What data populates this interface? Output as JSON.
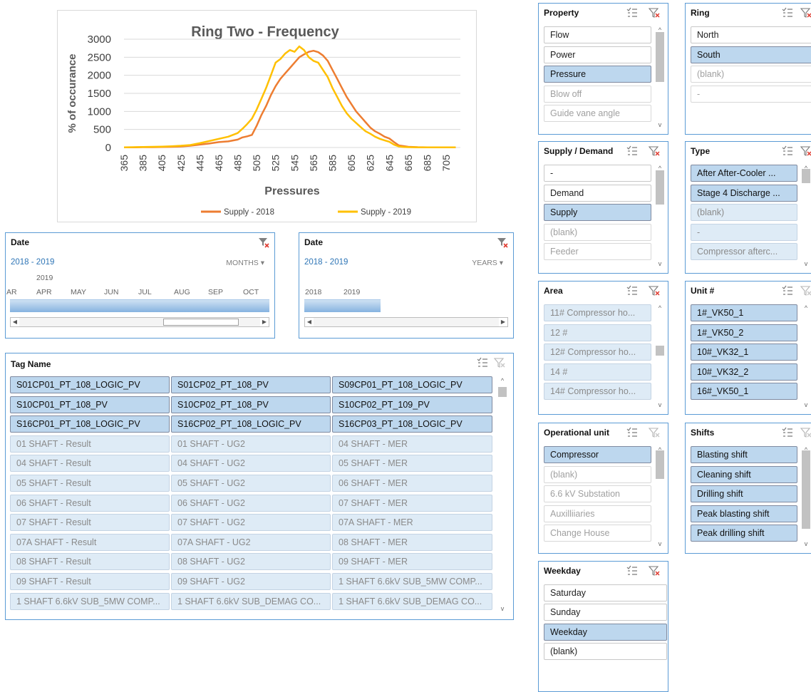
{
  "chart_data": {
    "type": "line",
    "title": "Ring Two - Frequency",
    "xlabel": "Pressures",
    "ylabel": "% of occurance",
    "ylim": [
      0,
      3000
    ],
    "yticks": [
      "0",
      "500",
      "1000",
      "1500",
      "2000",
      "2500",
      "3000"
    ],
    "xticks": [
      "365",
      "385",
      "405",
      "425",
      "445",
      "465",
      "485",
      "505",
      "525",
      "545",
      "565",
      "585",
      "605",
      "625",
      "645",
      "665",
      "685",
      "705"
    ],
    "xlim": [
      365,
      720
    ],
    "grid": true,
    "legend_position": "bottom",
    "series": [
      {
        "name": "Supply - 2018",
        "color": "#ed7d31",
        "x": [
          365,
          375,
          385,
          395,
          405,
          415,
          425,
          435,
          445,
          455,
          465,
          475,
          485,
          490,
          495,
          500,
          505,
          510,
          515,
          520,
          525,
          530,
          535,
          540,
          545,
          550,
          555,
          560,
          565,
          570,
          575,
          580,
          585,
          590,
          595,
          600,
          605,
          610,
          615,
          620,
          625,
          630,
          635,
          640,
          645,
          650,
          655,
          660,
          665,
          675,
          685,
          695,
          705,
          715
        ],
        "values": [
          5,
          5,
          10,
          10,
          15,
          20,
          30,
          50,
          80,
          110,
          150,
          170,
          220,
          280,
          310,
          350,
          600,
          900,
          1150,
          1450,
          1700,
          1900,
          2050,
          2200,
          2350,
          2500,
          2580,
          2650,
          2680,
          2640,
          2550,
          2400,
          2150,
          1900,
          1650,
          1400,
          1200,
          1000,
          850,
          700,
          550,
          450,
          380,
          300,
          250,
          150,
          60,
          40,
          20,
          10,
          5,
          5,
          5,
          5
        ]
      },
      {
        "name": "Supply - 2019",
        "color": "#ffc000",
        "x": [
          365,
          375,
          385,
          395,
          405,
          415,
          425,
          435,
          445,
          455,
          465,
          475,
          485,
          490,
          495,
          500,
          505,
          510,
          515,
          520,
          525,
          530,
          535,
          540,
          545,
          550,
          555,
          560,
          565,
          570,
          575,
          580,
          585,
          590,
          595,
          600,
          605,
          610,
          615,
          620,
          625,
          630,
          635,
          640,
          645,
          650,
          655,
          660,
          665,
          675,
          685,
          695,
          705,
          715
        ],
        "values": [
          5,
          10,
          15,
          20,
          25,
          35,
          50,
          70,
          120,
          180,
          240,
          300,
          400,
          520,
          650,
          800,
          1050,
          1350,
          1650,
          2000,
          2350,
          2450,
          2600,
          2700,
          2650,
          2800,
          2700,
          2500,
          2400,
          2350,
          2150,
          1950,
          1650,
          1400,
          1150,
          950,
          800,
          680,
          560,
          450,
          380,
          300,
          240,
          200,
          160,
          80,
          30,
          15,
          10,
          5,
          5,
          5,
          5,
          5
        ]
      }
    ]
  },
  "property": {
    "title": "Property",
    "items": [
      {
        "label": "Flow",
        "state": "normal"
      },
      {
        "label": "Power",
        "state": "normal"
      },
      {
        "label": "Pressure",
        "state": "selected"
      },
      {
        "label": "Blow off",
        "state": "dim"
      },
      {
        "label": "Guide vane angle",
        "state": "dim"
      }
    ]
  },
  "ring": {
    "title": "Ring",
    "items": [
      {
        "label": "North",
        "state": "normal"
      },
      {
        "label": "South",
        "state": "selected"
      },
      {
        "label": "(blank)",
        "state": "dim"
      },
      {
        "label": "-",
        "state": "dim"
      }
    ]
  },
  "supply_demand": {
    "title": "Supply / Demand",
    "items": [
      {
        "label": "-",
        "state": "normal"
      },
      {
        "label": "Demand",
        "state": "normal"
      },
      {
        "label": "Supply",
        "state": "selected"
      },
      {
        "label": "(blank)",
        "state": "dim"
      },
      {
        "label": "Feeder",
        "state": "dim"
      }
    ]
  },
  "type": {
    "title": "Type",
    "items": [
      {
        "label": "After After-Cooler ...",
        "state": "selected"
      },
      {
        "label": "Stage 4 Discharge ...",
        "state": "selected"
      },
      {
        "label": "(blank)",
        "state": "seldim"
      },
      {
        "label": "-",
        "state": "seldim"
      },
      {
        "label": "Compressor afterc...",
        "state": "seldim"
      }
    ]
  },
  "area": {
    "title": "Area",
    "items": [
      {
        "label": "11# Compressor ho...",
        "state": "seldim"
      },
      {
        "label": "12 #",
        "state": "seldim"
      },
      {
        "label": "12# Compressor ho...",
        "state": "seldim"
      },
      {
        "label": "14 #",
        "state": "seldim"
      },
      {
        "label": "14# Compressor ho...",
        "state": "seldim"
      }
    ]
  },
  "unit": {
    "title": "Unit #",
    "items": [
      {
        "label": "1#_VK50_1",
        "state": "selected"
      },
      {
        "label": "1#_VK50_2",
        "state": "selected"
      },
      {
        "label": "10#_VK32_1",
        "state": "selected"
      },
      {
        "label": "10#_VK32_2",
        "state": "selected"
      },
      {
        "label": "16#_VK50_1",
        "state": "selected"
      }
    ]
  },
  "operational_unit": {
    "title": "Operational unit",
    "items": [
      {
        "label": "Compressor",
        "state": "selected"
      },
      {
        "label": "(blank)",
        "state": "dim"
      },
      {
        "label": "6.6 kV Substation",
        "state": "dim"
      },
      {
        "label": "Auxilliiaries",
        "state": "dim"
      },
      {
        "label": "Change House",
        "state": "dim"
      }
    ]
  },
  "shifts": {
    "title": "Shifts",
    "items": [
      {
        "label": "Blasting shift",
        "state": "selected"
      },
      {
        "label": "Cleaning shift",
        "state": "selected"
      },
      {
        "label": "Drilling shift",
        "state": "selected"
      },
      {
        "label": "Peak blasting shift",
        "state": "selected"
      },
      {
        "label": "Peak drilling shift",
        "state": "selected"
      }
    ]
  },
  "weekday": {
    "title": "Weekday",
    "items": [
      {
        "label": "Saturday",
        "state": "normal"
      },
      {
        "label": "Sunday",
        "state": "normal"
      },
      {
        "label": "Weekday",
        "state": "selected"
      },
      {
        "label": "(blank)",
        "state": "normal"
      }
    ]
  },
  "timeline_months": {
    "title": "Date",
    "range": "2018 - 2019",
    "level": "MONTHS",
    "year": "2019",
    "months": [
      "AR",
      "APR",
      "MAY",
      "JUN",
      "JUL",
      "AUG",
      "SEP",
      "OCT"
    ]
  },
  "timeline_years": {
    "title": "Date",
    "range": "2018 - 2019",
    "level": "YEARS",
    "years": [
      "2018",
      "2019"
    ]
  },
  "tagname": {
    "title": "Tag Name",
    "rows": [
      [
        {
          "label": "S01CP01_PT_108_LOGIC_PV",
          "state": "selected"
        },
        {
          "label": "S01CP02_PT_108_PV",
          "state": "selected"
        },
        {
          "label": "S09CP01_PT_108_LOGIC_PV",
          "state": "selected"
        }
      ],
      [
        {
          "label": "S10CP01_PT_108_PV",
          "state": "selected"
        },
        {
          "label": "S10CP02_PT_108_PV",
          "state": "selected"
        },
        {
          "label": "S10CP02_PT_109_PV",
          "state": "selected"
        }
      ],
      [
        {
          "label": "S16CP01_PT_108_LOGIC_PV",
          "state": "selected"
        },
        {
          "label": "S16CP02_PT_108_LOGIC_PV",
          "state": "selected"
        },
        {
          "label": "S16CP03_PT_108_LOGIC_PV",
          "state": "selected"
        }
      ],
      [
        {
          "label": "01 SHAFT - Result",
          "state": "seldim"
        },
        {
          "label": "01 SHAFT - UG2",
          "state": "seldim"
        },
        {
          "label": "04 SHAFT - MER",
          "state": "seldim"
        }
      ],
      [
        {
          "label": "04 SHAFT - Result",
          "state": "seldim"
        },
        {
          "label": "04 SHAFT - UG2",
          "state": "seldim"
        },
        {
          "label": "05 SHAFT - MER",
          "state": "seldim"
        }
      ],
      [
        {
          "label": "05 SHAFT - Result",
          "state": "seldim"
        },
        {
          "label": "05 SHAFT - UG2",
          "state": "seldim"
        },
        {
          "label": "06 SHAFT - MER",
          "state": "seldim"
        }
      ],
      [
        {
          "label": "06 SHAFT - Result",
          "state": "seldim"
        },
        {
          "label": "06 SHAFT - UG2",
          "state": "seldim"
        },
        {
          "label": "07 SHAFT - MER",
          "state": "seldim"
        }
      ],
      [
        {
          "label": "07 SHAFT - Result",
          "state": "seldim"
        },
        {
          "label": "07 SHAFT - UG2",
          "state": "seldim"
        },
        {
          "label": "07A SHAFT - MER",
          "state": "seldim"
        }
      ],
      [
        {
          "label": "07A SHAFT - Result",
          "state": "seldim"
        },
        {
          "label": "07A SHAFT - UG2",
          "state": "seldim"
        },
        {
          "label": "08 SHAFT - MER",
          "state": "seldim"
        }
      ],
      [
        {
          "label": "08 SHAFT - Result",
          "state": "seldim"
        },
        {
          "label": "08 SHAFT - UG2",
          "state": "seldim"
        },
        {
          "label": "09 SHAFT - MER",
          "state": "seldim"
        }
      ],
      [
        {
          "label": "09 SHAFT - Result",
          "state": "seldim"
        },
        {
          "label": "09 SHAFT - UG2",
          "state": "seldim"
        },
        {
          "label": "1 SHAFT 6.6kV SUB_5MW COMP...",
          "state": "seldim"
        }
      ],
      [
        {
          "label": "1 SHAFT 6.6kV SUB_5MW COMP...",
          "state": "seldim"
        },
        {
          "label": "1 SHAFT 6.6kV SUB_DEMAG CO...",
          "state": "seldim"
        },
        {
          "label": "1 SHAFT 6.6kV SUB_DEMAG CO...",
          "state": "seldim"
        }
      ]
    ]
  }
}
